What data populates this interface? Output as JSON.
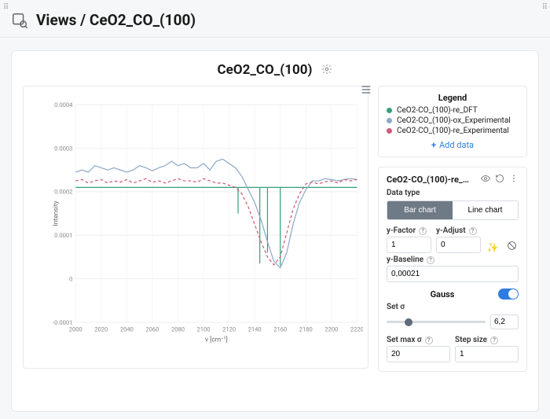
{
  "breadcrumb": "Views / CeO2_CO_(100)",
  "title": "CeO2_CO_(100)",
  "legend": {
    "title": "Legend",
    "items": [
      {
        "label": "CeO2-CO_(100)-re_DFT",
        "color": "#34a17b"
      },
      {
        "label": "CeO2-CO_(100)-ox_Experimental",
        "color": "#8ea9c9"
      },
      {
        "label": "CeO2-CO_(100)-re_Experimental",
        "color": "#cf5a78"
      }
    ],
    "add_label": "Add data"
  },
  "controls": {
    "title": "CeO2-CO_(100)-re_…",
    "data_type_label": "Data type",
    "bar_label": "Bar chart",
    "line_label": "Line chart",
    "y_factor_label": "y-Factor",
    "y_factor_value": "1",
    "y_adjust_label": "y-Adjust",
    "y_adjust_value": "0",
    "y_baseline_label": "y-Baseline",
    "y_baseline_value": "0,00021",
    "gauss_label": "Gauss",
    "set_sigma_label": "Set σ",
    "sigma_value": "6,2",
    "set_max_sigma_label": "Set max σ",
    "max_sigma_value": "20",
    "step_size_label": "Step size",
    "step_size_value": "1"
  },
  "chart_data": {
    "type": "line",
    "title": "CeO2_CO_(100)",
    "xlabel": "ν [cm⁻¹]",
    "ylabel": "Intensity",
    "xlim": [
      2000,
      2220
    ],
    "ylim": [
      -0.0001,
      0.0004
    ],
    "yticks": [
      -0.0001,
      0,
      0.0001,
      0.0002,
      0.0003,
      0.0004
    ],
    "xticks": [
      2000,
      2020,
      2040,
      2060,
      2080,
      2100,
      2120,
      2140,
      2160,
      2180,
      2200,
      2220
    ],
    "series": [
      {
        "name": "CeO2-CO_(100)-re_DFT",
        "color": "#34a17b",
        "style": "solid-bars",
        "baseline": 0.00021,
        "bars": [
          {
            "x": 2127,
            "y": 0.00015
          },
          {
            "x": 2144,
            "y": 3.5e-05
          },
          {
            "x": 2150,
            "y": 6e-05
          },
          {
            "x": 2160,
            "y": 3e-05
          }
        ]
      },
      {
        "name": "CeO2-CO_(100)-ox_Experimental",
        "color": "#8ea9c9",
        "style": "solid",
        "values": [
          [
            2000,
            0.000245
          ],
          [
            2005,
            0.00025
          ],
          [
            2010,
            0.000245
          ],
          [
            2015,
            0.00026
          ],
          [
            2020,
            0.000255
          ],
          [
            2025,
            0.00025
          ],
          [
            2030,
            0.000255
          ],
          [
            2035,
            0.00025
          ],
          [
            2040,
            0.000245
          ],
          [
            2045,
            0.00025
          ],
          [
            2050,
            0.00026
          ],
          [
            2055,
            0.000255
          ],
          [
            2060,
            0.000248
          ],
          [
            2065,
            0.000255
          ],
          [
            2070,
            0.00026
          ],
          [
            2075,
            0.00027
          ],
          [
            2080,
            0.00026
          ],
          [
            2085,
            0.000265
          ],
          [
            2090,
            0.000255
          ],
          [
            2095,
            0.000255
          ],
          [
            2100,
            0.000265
          ],
          [
            2105,
            0.00025
          ],
          [
            2110,
            0.00027
          ],
          [
            2115,
            0.000275
          ],
          [
            2120,
            0.000265
          ],
          [
            2125,
            0.000255
          ],
          [
            2130,
            0.000235
          ],
          [
            2135,
            0.000205
          ],
          [
            2140,
            0.000175
          ],
          [
            2145,
            0.000135
          ],
          [
            2150,
            8.5e-05
          ],
          [
            2155,
            4e-05
          ],
          [
            2160,
            2.5e-05
          ],
          [
            2165,
            6e-05
          ],
          [
            2170,
            0.000125
          ],
          [
            2175,
            0.000175
          ],
          [
            2180,
            0.000205
          ],
          [
            2185,
            0.000225
          ],
          [
            2190,
            0.000225
          ],
          [
            2195,
            0.00023
          ],
          [
            2200,
            0.000228
          ],
          [
            2205,
            0.000225
          ],
          [
            2210,
            0.000228
          ],
          [
            2215,
            0.00023
          ],
          [
            2220,
            0.000228
          ]
        ]
      },
      {
        "name": "CeO2-CO_(100)-re_Experimental",
        "color": "#cf5a78",
        "style": "dashed",
        "values": [
          [
            2000,
            0.000225
          ],
          [
            2005,
            0.000228
          ],
          [
            2010,
            0.00022
          ],
          [
            2015,
            0.000225
          ],
          [
            2020,
            0.000228
          ],
          [
            2025,
            0.00022
          ],
          [
            2030,
            0.000225
          ],
          [
            2035,
            0.000222
          ],
          [
            2040,
            0.000228
          ],
          [
            2045,
            0.00022
          ],
          [
            2050,
            0.000225
          ],
          [
            2055,
            0.00023
          ],
          [
            2060,
            0.000222
          ],
          [
            2065,
            0.000225
          ],
          [
            2070,
            0.00022
          ],
          [
            2075,
            0.000225
          ],
          [
            2080,
            0.00023
          ],
          [
            2085,
            0.000225
          ],
          [
            2090,
            0.000225
          ],
          [
            2095,
            0.000222
          ],
          [
            2100,
            0.00023
          ],
          [
            2105,
            0.000225
          ],
          [
            2110,
            0.00022
          ],
          [
            2115,
            0.00022
          ],
          [
            2120,
            0.000215
          ],
          [
            2125,
            0.00021
          ],
          [
            2130,
            0.000195
          ],
          [
            2135,
            0.000165
          ],
          [
            2140,
            0.000125
          ],
          [
            2145,
            8.5e-05
          ],
          [
            2150,
            5e-05
          ],
          [
            2155,
            3.2e-05
          ],
          [
            2160,
            5e-05
          ],
          [
            2165,
            0.000105
          ],
          [
            2170,
            0.00016
          ],
          [
            2175,
            0.000195
          ],
          [
            2180,
            0.000218
          ],
          [
            2185,
            0.000222
          ],
          [
            2190,
            0.000218
          ],
          [
            2195,
            0.000223
          ],
          [
            2200,
            0.000225
          ],
          [
            2205,
            0.00022
          ],
          [
            2210,
            0.000228
          ],
          [
            2215,
            0.000225
          ],
          [
            2220,
            0.000228
          ]
        ]
      }
    ]
  }
}
